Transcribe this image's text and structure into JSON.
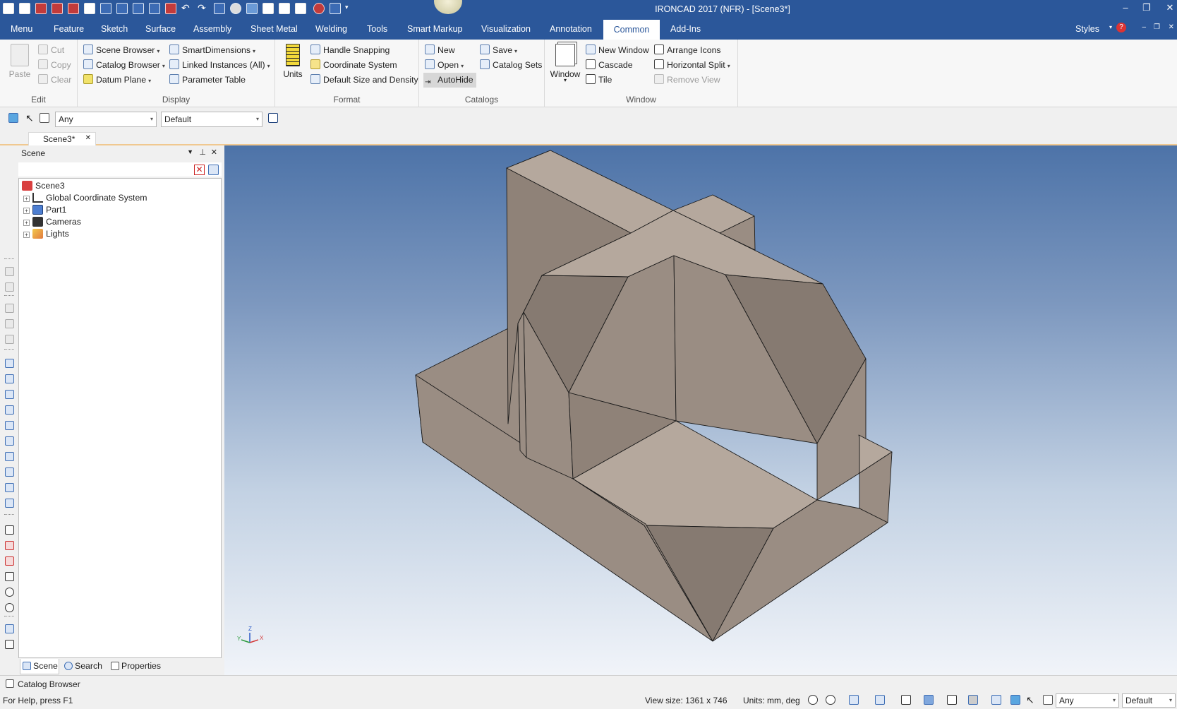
{
  "titlebar": {
    "title": "IRONCAD 2017 (NFR) - [Scene3*]",
    "quick_access_icons": [
      "app-logo-icon",
      "new-doc-icon",
      "open-icon",
      "save-pdf-icon",
      "export-icon",
      "print-icon",
      "folder-icon",
      "save-icon",
      "edit-icon",
      "tool-icon",
      "cut-icon",
      "undo-icon",
      "redo-icon",
      "sphere-icon",
      "shape-icon",
      "properties-icon",
      "list-icon",
      "copy-icon",
      "help-icon",
      "hat-icon",
      "more-icon"
    ],
    "window_controls": [
      "minimize",
      "restore",
      "close"
    ]
  },
  "menubar": {
    "tabs": [
      "Menu",
      "Feature",
      "Sketch",
      "Surface",
      "Assembly",
      "Sheet Metal",
      "Welding",
      "Tools",
      "Smart Markup",
      "Visualization",
      "Annotation",
      "Common",
      "Add-Ins"
    ],
    "active_tab": "Common",
    "styles_label": "Styles"
  },
  "ribbon": {
    "edit": {
      "label": "Edit",
      "paste": "Paste",
      "cut": "Cut",
      "copy": "Copy",
      "clear": "Clear"
    },
    "display": {
      "label": "Display",
      "scene_browser": "Scene Browser",
      "catalog_browser": "Catalog Browser",
      "datum_plane": "Datum Plane",
      "smart_dimensions": "SmartDimensions",
      "linked_instances": "Linked Instances (All)",
      "parameter_table": "Parameter Table"
    },
    "format": {
      "label": "Format",
      "units": "Units",
      "handle_snapping": "Handle Snapping",
      "coordinate_system": "Coordinate System",
      "default_size": "Default Size and Density"
    },
    "catalogs": {
      "label": "Catalogs",
      "new": "New",
      "open": "Open",
      "autohide": "AutoHide",
      "save": "Save",
      "catalog_sets": "Catalog Sets"
    },
    "window": {
      "label": "Window",
      "window": "Window",
      "new_window": "New Window",
      "cascade": "Cascade",
      "tile": "Tile",
      "arrange_icons": "Arrange Icons",
      "horizontal_split": "Horizontal Split",
      "remove_view": "Remove View"
    }
  },
  "toolrow": {
    "filter_value": "Any",
    "style_value": "Default"
  },
  "doc_tab": {
    "label": "Scene3*"
  },
  "scene_panel": {
    "title": "Scene",
    "tree": [
      {
        "label": "Scene3",
        "icon": "scene-icon"
      },
      {
        "label": "Global Coordinate System",
        "icon": "coordinate-system-icon"
      },
      {
        "label": "Part1",
        "icon": "part-icon"
      },
      {
        "label": "Cameras",
        "icon": "camera-icon"
      },
      {
        "label": "Lights",
        "icon": "light-icon"
      }
    ],
    "tabs": [
      "Scene",
      "Search",
      "Properties"
    ],
    "active_tab": "Scene"
  },
  "viewport": {
    "axes": {
      "x": "X",
      "y": "Y",
      "z": "Z"
    }
  },
  "catalog_bar": {
    "label": "Catalog Browser"
  },
  "statusbar": {
    "help": "For Help, press F1",
    "view_size": "View size: 1361 x 746",
    "units": "Units: mm, deg",
    "filter": "Any",
    "style": "Default"
  },
  "colors": {
    "accent": "#2b579a",
    "model_light": "#b5a89d",
    "model_mid": "#9a8d83",
    "model_dark": "#867a71"
  }
}
